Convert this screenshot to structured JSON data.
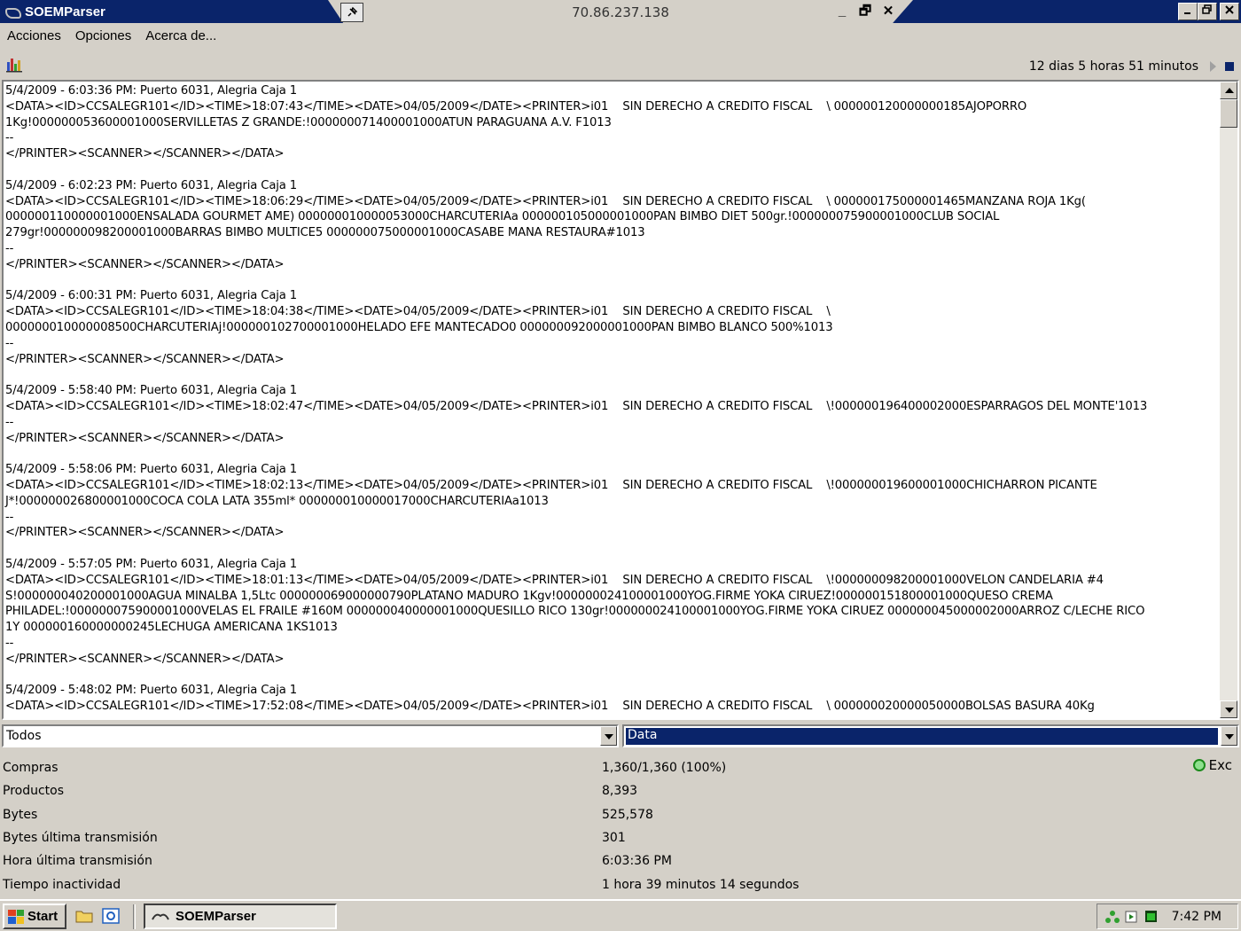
{
  "window": {
    "title": "SOEMParser",
    "remote_host": "70.86.237.138",
    "remote_controls": [
      "_",
      "🗗",
      "✕"
    ]
  },
  "menu": {
    "items": [
      "Acciones",
      "Opciones",
      "Acerca de..."
    ]
  },
  "toolbar": {
    "uptime": "12 dias 5 horas 51 minutos"
  },
  "log": {
    "entries": [
      {
        "header": "5/4/2009 - 6:03:36 PM: Puerto 6031, Alegria Caja 1",
        "lines": [
          "<DATA><ID>CCSALEGR101</ID><TIME>18:07:43</TIME><DATE>04/05/2009</DATE><PRINTER>i01    SIN DERECHO A CREDITO FISCAL    \\ 000000120000000185AJOPORRO",
          "1Kg!000000053600001000SERVILLETAS Z GRANDE:!000000071400001000ATUN PARAGUANA A.V. F1013",
          "--",
          "</PRINTER><SCANNER></SCANNER></DATA>"
        ]
      },
      {
        "header": "5/4/2009 - 6:02:23 PM: Puerto 6031, Alegria Caja 1",
        "lines": [
          "<DATA><ID>CCSALEGR101</ID><TIME>18:06:29</TIME><DATE>04/05/2009</DATE><PRINTER>i01    SIN DERECHO A CREDITO FISCAL    \\ 000000175000001465MANZANA ROJA 1Kg(",
          "000000110000001000ENSALADA GOURMET AME) 000000010000053000CHARCUTERIAa 000000105000001000PAN BIMBO DIET 500gr.!000000075900001000CLUB SOCIAL",
          "279gr!000000098200001000BARRAS BIMBO MULTICE5 000000075000001000CASABE MANA RESTAURA#1013",
          "--",
          "</PRINTER><SCANNER></SCANNER></DATA>"
        ]
      },
      {
        "header": "5/4/2009 - 6:00:31 PM: Puerto 6031, Alegria Caja 1",
        "lines": [
          "<DATA><ID>CCSALEGR101</ID><TIME>18:04:38</TIME><DATE>04/05/2009</DATE><PRINTER>i01    SIN DERECHO A CREDITO FISCAL    \\",
          "000000010000008500CHARCUTERIAj!000000102700001000HELADO EFE MANTECADO0 000000092000001000PAN BIMBO BLANCO 500%1013",
          "--",
          "</PRINTER><SCANNER></SCANNER></DATA>"
        ]
      },
      {
        "header": "5/4/2009 - 5:58:40 PM: Puerto 6031, Alegria Caja 1",
        "lines": [
          "<DATA><ID>CCSALEGR101</ID><TIME>18:02:47</TIME><DATE>04/05/2009</DATE><PRINTER>i01    SIN DERECHO A CREDITO FISCAL    \\!000000196400002000ESPARRAGOS DEL MONTE'1013",
          "--",
          "</PRINTER><SCANNER></SCANNER></DATA>"
        ]
      },
      {
        "header": "5/4/2009 - 5:58:06 PM: Puerto 6031, Alegria Caja 1",
        "lines": [
          "<DATA><ID>CCSALEGR101</ID><TIME>18:02:13</TIME><DATE>04/05/2009</DATE><PRINTER>i01    SIN DERECHO A CREDITO FISCAL    \\!000000019600001000CHICHARRON PICANTE",
          "J*!000000026800001000COCA COLA LATA 355ml* 000000010000017000CHARCUTERIAa1013",
          "--",
          "</PRINTER><SCANNER></SCANNER></DATA>"
        ]
      },
      {
        "header": "5/4/2009 - 5:57:05 PM: Puerto 6031, Alegria Caja 1",
        "lines": [
          "<DATA><ID>CCSALEGR101</ID><TIME>18:01:13</TIME><DATE>04/05/2009</DATE><PRINTER>i01    SIN DERECHO A CREDITO FISCAL    \\!000000098200001000VELON CANDELARIA #4",
          "S!000000040200001000AGUA MINALBA 1,5Ltc 000000069000000790PLATANO MADURO 1Kgv!000000024100001000YOG.FIRME YOKA CIRUEZ!000000151800001000QUESO CREMA",
          "PHILADEL:!000000075900001000VELAS EL FRAILE #160M 000000040000001000QUESILLO RICO 130gr!000000024100001000YOG.FIRME YOKA CIRUEZ 000000045000002000ARROZ C/LECHE RICO",
          "1Y 000000160000000245LECHUGA AMERICANA 1KS1013",
          "--",
          "</PRINTER><SCANNER></SCANNER></DATA>"
        ]
      },
      {
        "header": "5/4/2009 - 5:48:02 PM: Puerto 6031, Alegria Caja 1",
        "lines": [
          "<DATA><ID>CCSALEGR101</ID><TIME>17:52:08</TIME><DATE>04/05/2009</DATE><PRINTER>i01    SIN DERECHO A CREDITO FISCAL    \\ 000000020000050000BOLSAS BASURA 40Kg"
        ]
      }
    ]
  },
  "filters": {
    "left_value": "Todos",
    "right_value": "Data"
  },
  "stats": [
    {
      "label": "Compras",
      "value": "1,360/1,360 (100%)"
    },
    {
      "label": "Productos",
      "value": "8,393"
    },
    {
      "label": "Bytes",
      "value": "525,578"
    },
    {
      "label": "Bytes última transmisión",
      "value": "301"
    },
    {
      "label": "Hora última transmisión",
      "value": "6:03:36 PM"
    },
    {
      "label": "Tiempo inactividad",
      "value": "1 hora 39 minutos 14 segundos"
    }
  ],
  "status": {
    "label": "Exc",
    "color": "#1a8a1a"
  },
  "taskbar": {
    "start_label": "Start",
    "task_label": "SOEMParser",
    "clock": "7:42 PM"
  }
}
